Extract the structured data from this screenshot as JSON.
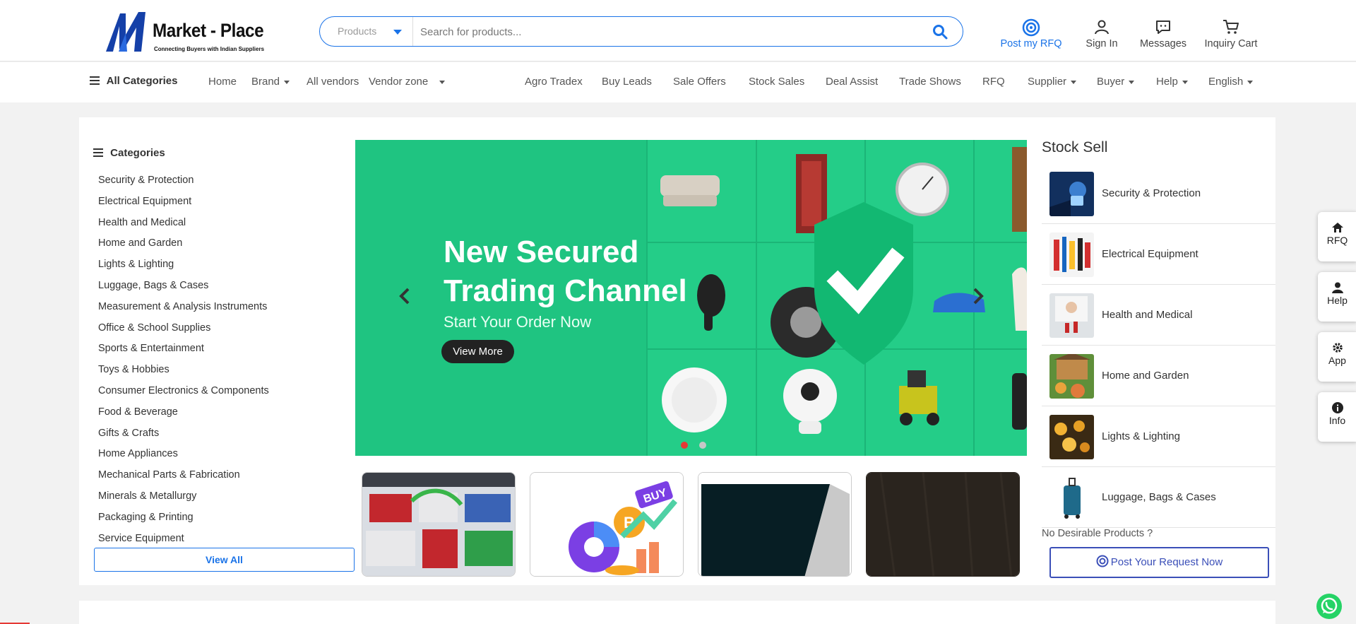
{
  "header": {
    "brand_name": "Market - Place",
    "brand_tagline": "Connecting Buyers with Indian Suppliers",
    "search": {
      "category_value": "Products",
      "placeholder": "Search for products..."
    },
    "actions": [
      {
        "label": "Post my RFQ",
        "icon": "target-icon"
      },
      {
        "label": "Sign In",
        "icon": "user-icon"
      },
      {
        "label": "Messages",
        "icon": "message-icon"
      },
      {
        "label": "Inquiry Cart",
        "icon": "cart-icon"
      }
    ],
    "accent_color": "#1a73e8"
  },
  "nav": {
    "all_categories": "All Categories",
    "items": [
      "Home",
      "Brand",
      "All vendors",
      "Vendor zone",
      "Agro Tradex",
      "Buy Leads",
      "Sale Offers",
      "Stock Sales",
      "Deal Assist",
      "Trade Shows",
      "RFQ",
      "Supplier",
      "Buyer",
      "Help",
      "English"
    ]
  },
  "categories": {
    "title": "Categories",
    "items": [
      "Security & Protection",
      "Electrical Equipment",
      "Health and Medical",
      "Home and Garden",
      "Lights & Lighting",
      "Luggage, Bags & Cases",
      "Measurement & Analysis Instruments",
      "Office & School Supplies",
      "Sports & Entertainment",
      "Toys & Hobbies",
      "Consumer Electronics & Components",
      "Food & Beverage",
      "Gifts & Crafts",
      "Home Appliances",
      "Mechanical Parts & Fabrication",
      "Minerals & Metallurgy",
      "Packaging & Printing",
      "Service Equipment"
    ],
    "view_all": "View All"
  },
  "banner": {
    "line1": "New Secured",
    "line2": "Trading Channel",
    "subtitle": "Start Your Order Now",
    "button": "View More",
    "background": "#1fc481",
    "active_slide": 1,
    "slide_count": 2
  },
  "thumbnails": [
    {
      "icon": "exhibition-hall-icon"
    },
    {
      "icon": "crypto-buy-icon",
      "badge": "BUY"
    },
    {
      "icon": "dark-panel-icon"
    },
    {
      "icon": "dark-texture-icon"
    }
  ],
  "stock_sell": {
    "title": "Stock Sell",
    "items": [
      "Security & Protection",
      "Electrical Equipment",
      "Health and Medical",
      "Home and Garden",
      "Lights & Lighting",
      "Luggage, Bags & Cases"
    ],
    "no_desirable": "No Desirable Products ?",
    "post_request": "Post Your Request Now"
  },
  "side_buttons": [
    {
      "label": "RFQ",
      "icon": "home-icon"
    },
    {
      "label": "Help",
      "icon": "user-icon"
    },
    {
      "label": "App",
      "icon": "gear-icon"
    },
    {
      "label": "Info",
      "icon": "info-icon"
    }
  ]
}
